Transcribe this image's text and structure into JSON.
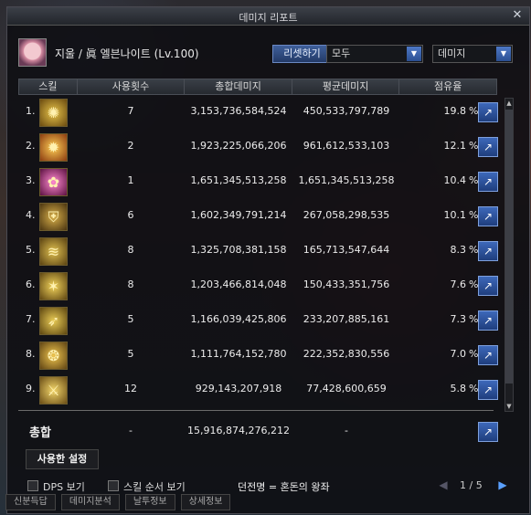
{
  "window": {
    "title": "데미지 리포트",
    "close_glyph": "✕"
  },
  "character": {
    "name": "지울 / 眞 엘븐나이트 (Lv.100)"
  },
  "controls": {
    "reset_label": "리셋하기",
    "filter_value": "모두",
    "metric_value": "데미지"
  },
  "columns": {
    "skill": "스킬",
    "uses": "사용횟수",
    "total": "총합데미지",
    "avg": "평균데미지",
    "share": "점유율"
  },
  "rows": [
    {
      "idx": "1.",
      "uses": "7",
      "total": "3,153,736,584,524",
      "avg": "450,533,797,789",
      "share": "19.8",
      "icon": "spiral-gold-icon"
    },
    {
      "idx": "2.",
      "uses": "2",
      "total": "1,923,225,066,206",
      "avg": "961,612,533,103",
      "share": "12.1",
      "icon": "flame-burst-icon"
    },
    {
      "idx": "3.",
      "uses": "1",
      "total": "1,651,345,513,258",
      "avg": "1,651,345,513,258",
      "share": "10.4",
      "icon": "pink-flower-icon"
    },
    {
      "idx": "4.",
      "uses": "6",
      "total": "1,602,349,791,214",
      "avg": "267,058,298,535",
      "share": "10.1",
      "icon": "shield-icon"
    },
    {
      "idx": "5.",
      "uses": "8",
      "total": "1,325,708,381,158",
      "avg": "165,713,547,644",
      "share": "8.3",
      "icon": "wave-slash-icon"
    },
    {
      "idx": "6.",
      "uses": "8",
      "total": "1,203,466,814,048",
      "avg": "150,433,351,756",
      "share": "7.6",
      "icon": "multi-strike-icon"
    },
    {
      "idx": "7.",
      "uses": "5",
      "total": "1,166,039,425,806",
      "avg": "233,207,885,161",
      "share": "7.3",
      "icon": "dash-slash-icon"
    },
    {
      "idx": "8.",
      "uses": "5",
      "total": "1,111,764,152,780",
      "avg": "222,352,830,556",
      "share": "7.0",
      "icon": "swirl-icon"
    },
    {
      "idx": "9.",
      "uses": "12",
      "total": "929,143,207,918",
      "avg": "77,428,600,659",
      "share": "5.8",
      "icon": "sword-icon"
    }
  ],
  "percent_sign": "%",
  "totals": {
    "label": "총합",
    "uses": "-",
    "total": "15,916,874,276,212",
    "avg": "-"
  },
  "settings_tab": "사용한 설정",
  "bottom": {
    "dps_label": "DPS 보기",
    "order_label": "스킬 순서 보기",
    "dungeon": "던전명 = 혼돈의 왕좌",
    "page": "1 / 5"
  },
  "under_tabs": [
    "신분득답",
    "데미지분석",
    "날투정보",
    "상세정보"
  ],
  "colors": {
    "accent_blue": "#2f55a0",
    "panel_bg": "#0e0e12",
    "text": "#ececec"
  }
}
